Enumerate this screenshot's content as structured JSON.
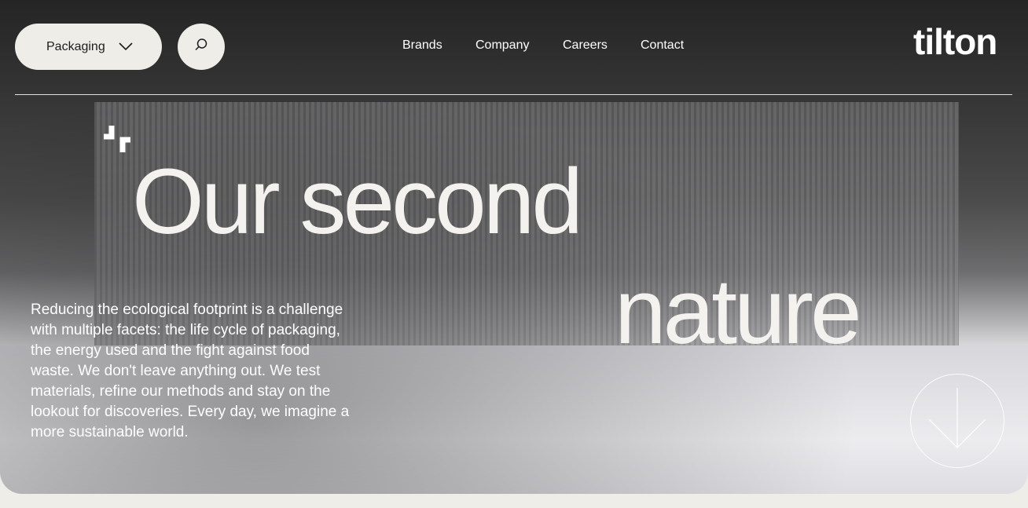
{
  "header": {
    "dropdown_label": "Packaging",
    "nav": [
      "Brands",
      "Company",
      "Careers",
      "Contact"
    ],
    "logo": "tilton"
  },
  "hero": {
    "headline_line1": "Our second",
    "headline_line2": "nature",
    "body": "Reducing the ecological footprint is a challenge with multiple facets: the life cycle of packaging, the energy used and the fight against food waste. We don't leave anything out. We test materials, refine our methods and stay on the lookout for discoveries. Every day, we imagine a more sustainable world."
  },
  "icons": {
    "dropdown": "chevron-down-icon",
    "search": "search-icon",
    "brand_mark": "spark-icon",
    "scroll": "arrow-down-icon"
  },
  "colors": {
    "pill_bg": "#efede8",
    "text_light": "#ffffff",
    "page_bg": "#efede8"
  }
}
